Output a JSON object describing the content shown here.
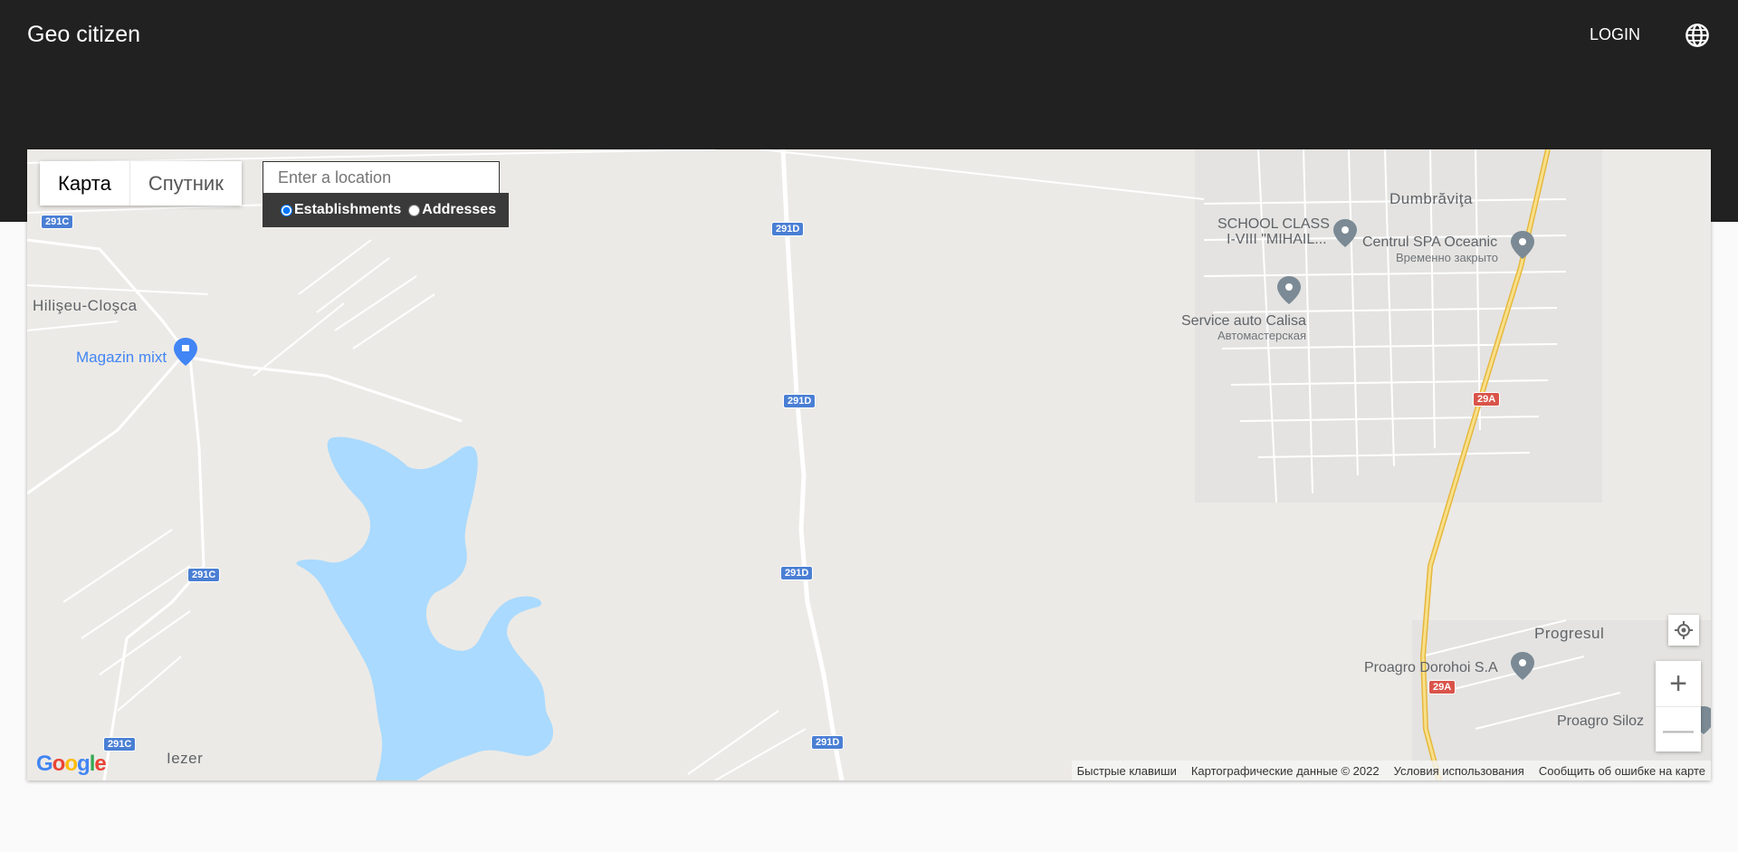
{
  "header": {
    "title": "Geo citizen",
    "login_label": "LOGIN"
  },
  "map_controls": {
    "map_type_map": "Карта",
    "map_type_satellite": "Спутник",
    "search_placeholder": "Enter a location",
    "option_establishments": "Establishments",
    "option_addresses": "Addresses",
    "zoom_in": "+",
    "zoom_out": "—"
  },
  "map_labels": {
    "places": {
      "hiliseu": "Hilişeu-Cloşca",
      "dumbravita": "Dumbrăviţa",
      "progresul": "Progresul",
      "iezer": "Iezer"
    },
    "pois": {
      "magazin": "Magazin mixt",
      "school_line1": "SCHOOL CLASS",
      "school_line2": "I-VIII \"MIHAIL...",
      "spa": "Centrul SPA Oceanic",
      "spa_status": "Временно закрыто",
      "service": "Service auto Calisa",
      "service_type": "Автомастерская",
      "proagro": "Proagro Dorohoi S.A",
      "proagro_siloz": "Proagro Siloz"
    },
    "shields": {
      "s1": "291C",
      "s2": "291C",
      "s3": "291C",
      "s4": "291D",
      "s5": "291D",
      "s6": "291D",
      "s7": "291D",
      "s8": "29A",
      "s9": "29A"
    }
  },
  "google_logo": "Google",
  "attribution": {
    "shortcuts": "Быстрые клавиши",
    "data": "Картографические данные © 2022",
    "terms": "Условия использования",
    "report": "Сообщить об ошибке на карте"
  },
  "colors": {
    "header_bg": "#212121",
    "map_bg": "#eceae6",
    "water": "#aadaff",
    "highway": "#f5d76e",
    "shield_blue": "#4a7fd4",
    "shield_red": "#d9544a"
  }
}
